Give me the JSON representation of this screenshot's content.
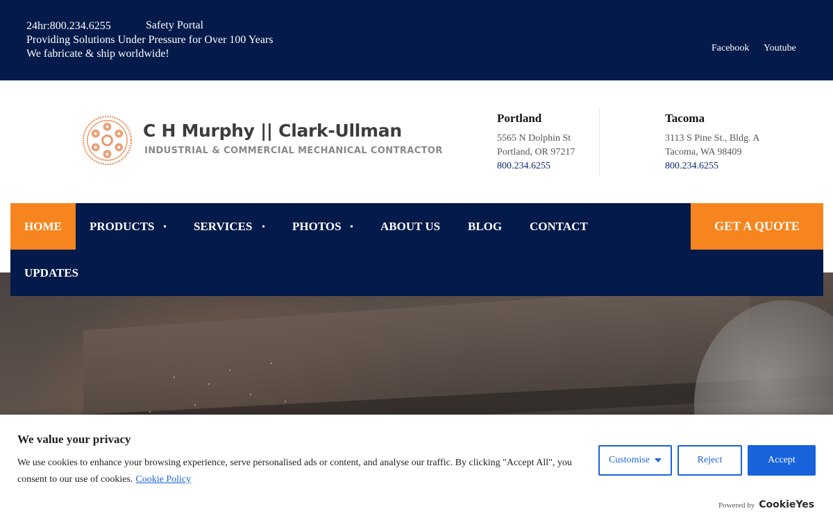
{
  "topbar": {
    "phone": "24hr:800.234.6255",
    "safety_portal": "Safety Portal",
    "tagline1": "Providing Solutions Under Pressure for Over 100 Years",
    "tagline2": "We fabricate & ship worldwide!",
    "social": {
      "facebook": "Facebook",
      "youtube": "Youtube"
    }
  },
  "logo": {
    "title": "C H Murphy || Clark-Ullman",
    "subtitle": "INDUSTRIAL & COMMERCIAL MECHANICAL CONTRACTOR",
    "icon": "gear-wheel-logo-icon"
  },
  "locations": [
    {
      "city": "Portland",
      "street": "5565 N Dolphin St",
      "city_line": "Portland, OR 97217",
      "phone": "800.234.6255"
    },
    {
      "city": "Tacoma",
      "street": "3113 S Pine St., Bldg. A",
      "city_line": "Tacoma, WA 98409",
      "phone": "800.234.6255"
    }
  ],
  "nav": {
    "items": [
      {
        "label": "HOME",
        "active": true
      },
      {
        "label": "PRODUCTS",
        "dropdown": true
      },
      {
        "label": "SERVICES",
        "dropdown": true
      },
      {
        "label": "PHOTOS",
        "dropdown": true
      },
      {
        "label": "ABOUT US"
      },
      {
        "label": "BLOG"
      },
      {
        "label": "CONTACT"
      },
      {
        "label": "UPDATES"
      }
    ],
    "cta": "GET A QUOTE"
  },
  "cookie": {
    "title": "We value your privacy",
    "text": "We use cookies to enhance your browsing experience, serve personalised ads or content, and analyse our traffic. By clicking \"Accept All\", you consent to our use of cookies.",
    "policy_link": "Cookie Policy",
    "customise": "Customise",
    "reject": "Reject",
    "accept": "Accept",
    "powered_by": "Powered by",
    "brand": "CookieYes"
  },
  "colors": {
    "navy": "#041a4a",
    "orange": "#f7851f",
    "cookie_blue": "#1863dc"
  }
}
